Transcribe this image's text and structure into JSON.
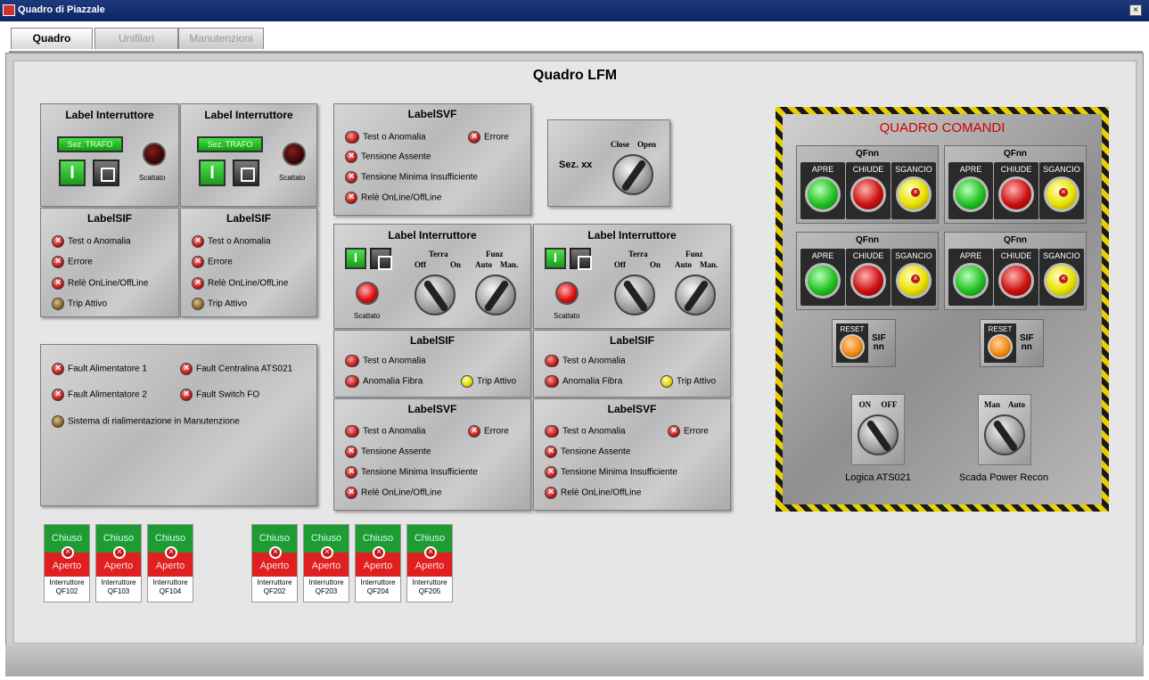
{
  "window": {
    "title": "Quadro di Piazzale",
    "close_glyph": "×"
  },
  "tabs": [
    {
      "label": "Quadro",
      "active": true
    },
    {
      "label": "Unifilari",
      "active": false
    },
    {
      "label": "Manutenzioni",
      "active": false
    }
  ],
  "page_title": "Quadro LFM",
  "interruttori_top": [
    {
      "title": "Label Interruttore",
      "lcd": "Sez. TRAFO",
      "t": "I",
      "status": "Scattato"
    },
    {
      "title": "Label Interruttore",
      "lcd": "Sez. TRAFO",
      "t": "I",
      "status": "Scattato"
    }
  ],
  "sif_left": [
    {
      "title": "LabelSIF",
      "items": [
        "Test o Anomalia",
        "Errore",
        "Relè OnLine/OffLine",
        "Trip Attivo"
      ]
    },
    {
      "title": "LabelSIF",
      "items": [
        "Test o Anomalia",
        "Errore",
        "Relè OnLine/OffLine",
        "Trip Attivo"
      ]
    }
  ],
  "svf_top": {
    "title": "LabelSVF",
    "items": [
      "Test o Anomalia",
      "Tensione Assente",
      "Tensione Minima Insufficiente",
      "Relè OnLine/OffLine"
    ],
    "side_item": "Errore"
  },
  "sez": {
    "label": "Sez. xx",
    "close": "Close",
    "open": "Open"
  },
  "interruttori_mid": [
    {
      "title": "Label Interruttore",
      "t": "I",
      "status": "Scattato",
      "terra": "Terra",
      "off": "Off",
      "on": "On",
      "funz": "Funz",
      "auto": "Auto",
      "man": "Man."
    },
    {
      "title": "Label Interruttore",
      "t": "I",
      "status": "Scattato",
      "terra": "Terra",
      "off": "Off",
      "on": "On",
      "funz": "Funz",
      "auto": "Auto",
      "man": "Man."
    }
  ],
  "sif_mid": [
    {
      "title": "LabelSIF",
      "items": [
        "Test o Anomalia",
        "Anomalia Fibra"
      ],
      "trip": "Trip Attivo"
    },
    {
      "title": "LabelSIF",
      "items": [
        "Test o Anomalia",
        "Anomalia Fibra"
      ],
      "trip": "Trip Attivo"
    }
  ],
  "svf_bottom": [
    {
      "title": "LabelSVF",
      "items": [
        "Test o Anomalia",
        "Tensione Assente",
        "Tensione Minima Insufficiente",
        "Relè OnLine/OffLine"
      ],
      "side_item": "Errore"
    },
    {
      "title": "LabelSVF",
      "items": [
        "Test o Anomalia",
        "Tensione Assente",
        "Tensione Minima Insufficiente",
        "Relè OnLine/OffLine"
      ],
      "side_item": "Errore"
    }
  ],
  "faults": {
    "a1": "Fault Alimentatore 1",
    "a2": "Fault Alimentatore 2",
    "c1": "Fault Centralina ATS021",
    "c2": "Fault Switch FO",
    "manut": "Sistema di rialimentazione in Manutenzione"
  },
  "comandi": {
    "title": "QUADRO COMANDI",
    "qf": [
      {
        "name": "QFnn",
        "apre": "APRE",
        "chiude": "CHIUDE",
        "sgancio": "SGANCIO"
      },
      {
        "name": "QFnn",
        "apre": "APRE",
        "chiude": "CHIUDE",
        "sgancio": "SGANCIO"
      },
      {
        "name": "QFnn",
        "apre": "APRE",
        "chiude": "CHIUDE",
        "sgancio": "SGANCIO"
      },
      {
        "name": "QFnn",
        "apre": "APRE",
        "chiude": "CHIUDE",
        "sgancio": "SGANCIO"
      }
    ],
    "reset": [
      {
        "btn": "RESET",
        "l1": "SIF",
        "l2": "nn"
      },
      {
        "btn": "RESET",
        "l1": "SIF",
        "l2": "nn"
      }
    ],
    "logica": {
      "on": "ON",
      "off": "OFF",
      "caption": "Logica ATS021"
    },
    "scada": {
      "man": "Man",
      "auto": "Auto",
      "caption": "Scada Power Recon"
    }
  },
  "breakers": [
    {
      "chiuso": "Chiuso",
      "aperto": "Aperto",
      "l1": "Interruttore",
      "l2": "QF102"
    },
    {
      "chiuso": "Chiuso",
      "aperto": "Aperto",
      "l1": "Interruttore",
      "l2": "QF103"
    },
    {
      "chiuso": "Chiuso",
      "aperto": "Aperto",
      "l1": "Interruttore",
      "l2": "QF104"
    },
    {
      "chiuso": "Chiuso",
      "aperto": "Aperto",
      "l1": "Interruttore",
      "l2": "QF202"
    },
    {
      "chiuso": "Chiuso",
      "aperto": "Aperto",
      "l1": "Interruttore",
      "l2": "QF203"
    },
    {
      "chiuso": "Chiuso",
      "aperto": "Aperto",
      "l1": "Interruttore",
      "l2": "QF204"
    },
    {
      "chiuso": "Chiuso",
      "aperto": "Aperto",
      "l1": "Interruttore",
      "l2": "QF205"
    }
  ]
}
